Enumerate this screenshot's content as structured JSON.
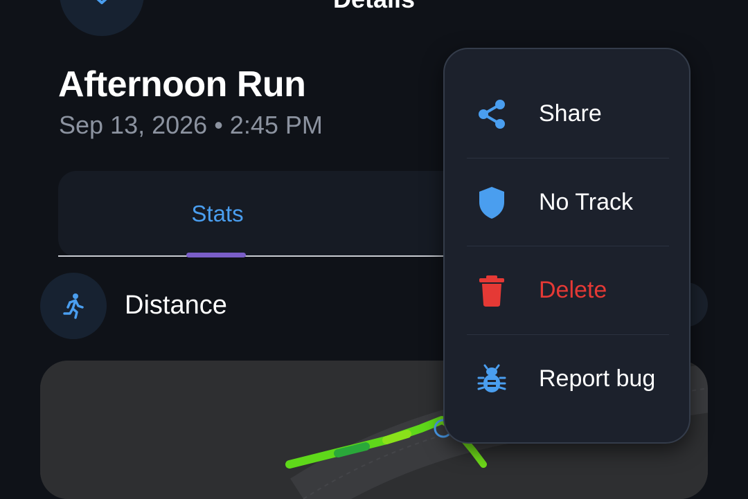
{
  "header": {
    "title": "Details",
    "back_icon": "chevron-down-icon",
    "more_icon": "more-vert-icon"
  },
  "activity": {
    "title": "Afternoon Run",
    "date": "Sep 13, 2026 • 2:45 PM"
  },
  "tabs": [
    {
      "label": "Stats",
      "selected": true
    }
  ],
  "metric": {
    "label": "Distance",
    "icon": "run-icon"
  },
  "menu": {
    "items": [
      {
        "label": "Share",
        "icon": "share-icon",
        "color": "#ffffff"
      },
      {
        "label": "No Track",
        "icon": "shield-icon",
        "color": "#ffffff"
      },
      {
        "label": "Delete",
        "icon": "trash-icon",
        "color": "#e53935"
      },
      {
        "label": "Report bug",
        "icon": "bug-icon",
        "color": "#ffffff"
      }
    ]
  },
  "colors": {
    "background": "#0f1218",
    "accent": "#4a9eef",
    "tab_indicator": "#7a5ec8",
    "danger": "#e53935",
    "menu_bg": "#1c212c"
  }
}
